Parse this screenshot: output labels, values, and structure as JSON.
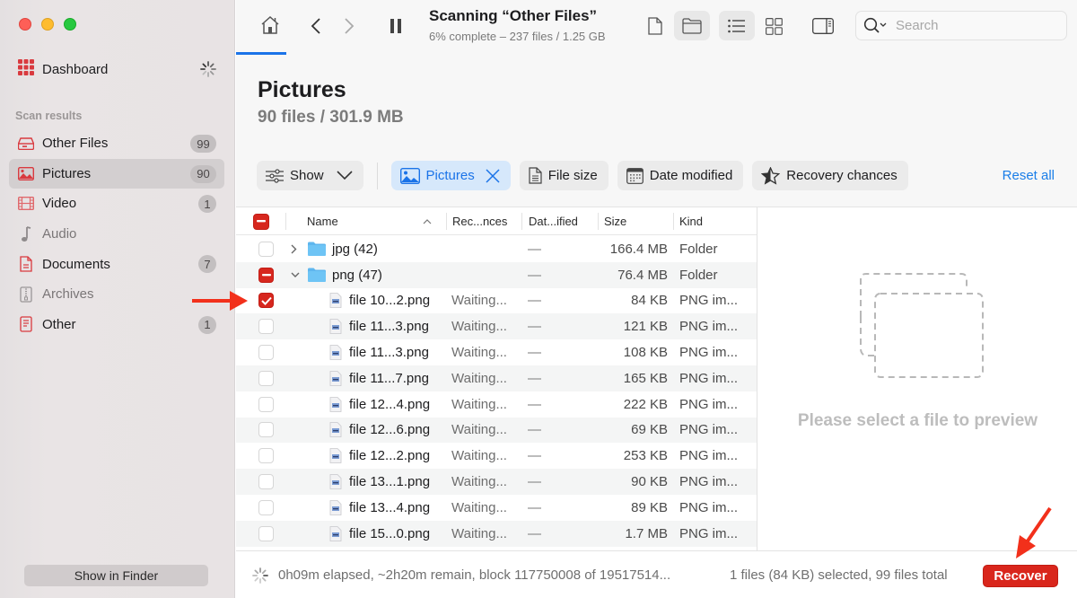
{
  "sidebar": {
    "dashboard_label": "Dashboard",
    "section_title": "Scan results",
    "items": [
      {
        "label": "Other Files",
        "count": "99",
        "icon": "drive-icon",
        "active": false,
        "dim": false
      },
      {
        "label": "Pictures",
        "count": "90",
        "icon": "picture-icon",
        "active": true,
        "dim": false
      },
      {
        "label": "Video",
        "count": "1",
        "icon": "film-icon",
        "active": false,
        "dim": false
      },
      {
        "label": "Audio",
        "count": "",
        "icon": "music-note-icon",
        "active": false,
        "dim": true
      },
      {
        "label": "Documents",
        "count": "7",
        "icon": "document-icon",
        "active": false,
        "dim": false
      },
      {
        "label": "Archives",
        "count": "",
        "icon": "archive-icon",
        "active": false,
        "dim": true
      },
      {
        "label": "Other",
        "count": "1",
        "icon": "text-file-icon",
        "active": false,
        "dim": false
      }
    ],
    "show_in_finder_label": "Show in Finder"
  },
  "toolbar": {
    "scan_title": "Scanning “Other Files”",
    "scan_subtitle": "6% complete – 237 files / 1.25 GB",
    "search_placeholder": "Search"
  },
  "header": {
    "title": "Pictures",
    "subtitle": "90 files / 301.9 MB"
  },
  "filters": {
    "show_label": "Show",
    "active_filter_label": "Pictures",
    "file_size_label": "File size",
    "date_modified_label": "Date modified",
    "recovery_chances_label": "Recovery chances",
    "reset_all_label": "Reset all"
  },
  "table": {
    "columns": {
      "name": "Name",
      "recovery": "Rec...nces",
      "date": "Dat...ified",
      "size": "Size",
      "kind": "Kind"
    },
    "rows": [
      {
        "type": "folder",
        "name": "jpg (42)",
        "recovery": "",
        "date": "—",
        "size": "166.4 MB",
        "kind": "Folder",
        "check": "off",
        "expanded": false
      },
      {
        "type": "folder",
        "name": "png (47)",
        "recovery": "",
        "date": "—",
        "size": "76.4 MB",
        "kind": "Folder",
        "check": "mixed",
        "expanded": true
      },
      {
        "type": "file",
        "name": "file 10...2.png",
        "recovery": "Waiting...",
        "date": "—",
        "size": "84 KB",
        "kind": "PNG im...",
        "check": "on"
      },
      {
        "type": "file",
        "name": "file 11...3.png",
        "recovery": "Waiting...",
        "date": "—",
        "size": "121 KB",
        "kind": "PNG im...",
        "check": "off"
      },
      {
        "type": "file",
        "name": "file 11...3.png",
        "recovery": "Waiting...",
        "date": "—",
        "size": "108 KB",
        "kind": "PNG im...",
        "check": "off"
      },
      {
        "type": "file",
        "name": "file 11...7.png",
        "recovery": "Waiting...",
        "date": "—",
        "size": "165 KB",
        "kind": "PNG im...",
        "check": "off"
      },
      {
        "type": "file",
        "name": "file 12...4.png",
        "recovery": "Waiting...",
        "date": "—",
        "size": "222 KB",
        "kind": "PNG im...",
        "check": "off"
      },
      {
        "type": "file",
        "name": "file 12...6.png",
        "recovery": "Waiting...",
        "date": "—",
        "size": "69 KB",
        "kind": "PNG im...",
        "check": "off"
      },
      {
        "type": "file",
        "name": "file 12...2.png",
        "recovery": "Waiting...",
        "date": "—",
        "size": "253 KB",
        "kind": "PNG im...",
        "check": "off"
      },
      {
        "type": "file",
        "name": "file 13...1.png",
        "recovery": "Waiting...",
        "date": "—",
        "size": "90 KB",
        "kind": "PNG im...",
        "check": "off"
      },
      {
        "type": "file",
        "name": "file 13...4.png",
        "recovery": "Waiting...",
        "date": "—",
        "size": "89 KB",
        "kind": "PNG im...",
        "check": "off"
      },
      {
        "type": "file",
        "name": "file 15...0.png",
        "recovery": "Waiting...",
        "date": "—",
        "size": "1.7 MB",
        "kind": "PNG im...",
        "check": "off"
      }
    ]
  },
  "preview": {
    "placeholder": "Please select a file to preview"
  },
  "footer": {
    "status": "0h09m elapsed, ~2h20m remain, block 117750008 of 19517514...",
    "selection": "1 files (84 KB) selected, 99 files total",
    "recover_label": "Recover"
  },
  "colors": {
    "accent_blue": "#1a73e8",
    "recover_red": "#d9261c",
    "annotation_arrow": "#f2301b"
  }
}
